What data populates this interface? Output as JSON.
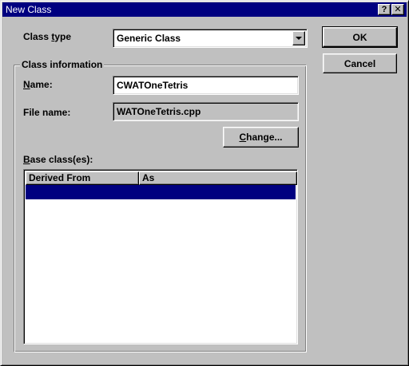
{
  "window": {
    "title": "New Class",
    "help_glyph": "?",
    "close_glyph": "✕"
  },
  "class_type": {
    "label_pre": "Class ",
    "label_u": "t",
    "label_post": "ype",
    "selected": "Generic Class"
  },
  "buttons": {
    "ok": "OK",
    "cancel": "Cancel",
    "change_u": "C",
    "change_rest": "hange..."
  },
  "class_info": {
    "group_title": "Class information",
    "name_label_u": "N",
    "name_label_rest": "ame:",
    "name_value": "CWATOneTetris",
    "file_label": "File name:",
    "file_value": "WATOneTetris.cpp",
    "base_label_u": "B",
    "base_label_rest": "ase class(es):"
  },
  "base_list": {
    "columns": [
      "Derived From",
      "As"
    ],
    "rows": []
  },
  "colors": {
    "titlebar": "#000080",
    "face": "#c0c0c0",
    "selection": "#000080"
  }
}
